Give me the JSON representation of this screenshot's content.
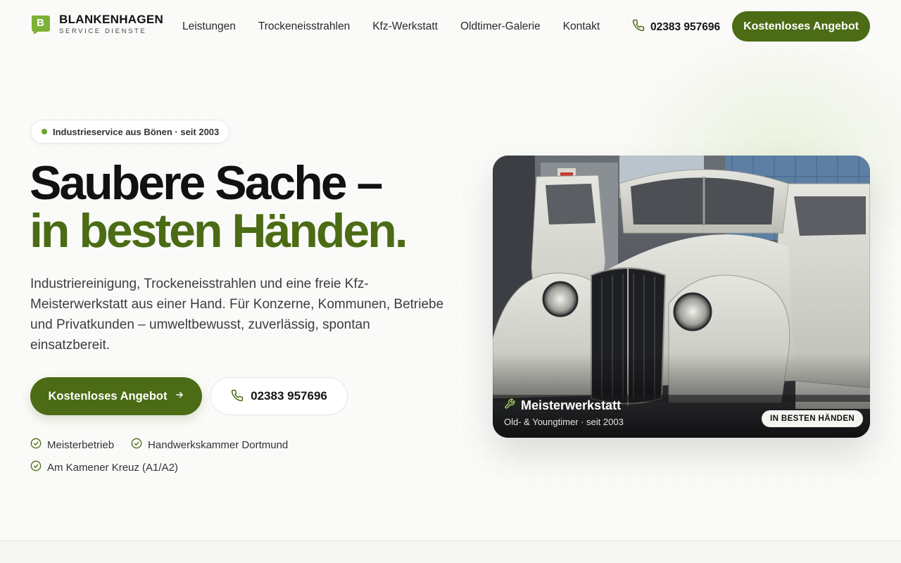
{
  "brand": {
    "letter": "B",
    "name": "BLANKENHAGEN",
    "tagline": "SERVICE DIENSTE",
    "accent": "#4b6b15",
    "dot_color": "#6aa32a"
  },
  "nav": {
    "items": [
      {
        "label": "Leistungen"
      },
      {
        "label": "Trockeneisstrahlen"
      },
      {
        "label": "Kfz-Werkstatt"
      },
      {
        "label": "Oldtimer-Galerie"
      },
      {
        "label": "Kontakt"
      }
    ],
    "phone": "02383 957696",
    "phone_icon": "phone-icon",
    "cta": "Kostenloses Angebot"
  },
  "hero": {
    "badge": "Industrieservice aus Bönen · seit 2003",
    "headline_line1": "Saubere Sache –",
    "headline_line2": "in besten Händen.",
    "lead": "Industriereinigung, Trockeneisstrahlen und eine freie Kfz-Meisterwerkstatt aus einer Hand. Für Konzerne, Kommunen, Betriebe und Privatkunden – umweltbewusst, zuverlässig, spontan einsatzbereit.",
    "primary_cta": "Kostenloses Angebot",
    "primary_cta_icon": "arrow-right-icon",
    "phone_cta": "02383 957696",
    "trust": [
      {
        "label": "Meisterbetrieb"
      },
      {
        "label": "Handwerkskammer Dortmund"
      },
      {
        "label": "Am Kamener Kreuz (A1/A2)"
      }
    ],
    "trust_icon": "check-circle-icon"
  },
  "photo_card": {
    "title": "Meisterwerkstatt",
    "title_icon": "wrench-icon",
    "subtitle": "Old- & Youngtimer · seit 2003",
    "badge": "IN BESTEN HÄNDEN"
  }
}
